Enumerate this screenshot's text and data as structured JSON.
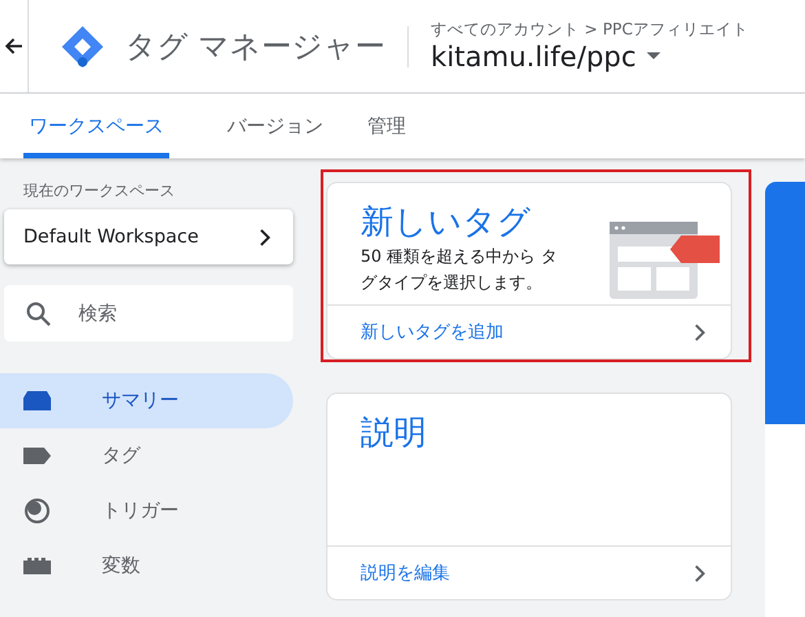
{
  "header": {
    "product": "タグ マネージャー",
    "breadcrumb": "すべてのアカウント > PPCアフィリエイト",
    "container": "kitamu.life/ppc"
  },
  "tabs": [
    {
      "label": "ワークスペース",
      "selected": true
    },
    {
      "label": "バージョン",
      "selected": false
    },
    {
      "label": "管理",
      "selected": false
    }
  ],
  "sidebar": {
    "workspace_label": "現在のワークスペース",
    "workspace": "Default Workspace",
    "search": {
      "placeholder": "検索"
    },
    "items": [
      {
        "label": "サマリー",
        "kind": "summary",
        "selected": true
      },
      {
        "label": "タグ",
        "kind": "tag",
        "selected": false
      },
      {
        "label": "トリガー",
        "kind": "trigger",
        "selected": false
      },
      {
        "label": "変数",
        "kind": "variable",
        "selected": false
      }
    ]
  },
  "cards": [
    {
      "title": "新しいタグ",
      "description": "50 種類を超える中から タグタイプを選択します。",
      "link": "新しいタグを追加",
      "highlighted": true
    },
    {
      "title": "説明",
      "link": "説明を編集",
      "highlighted": false
    }
  ]
}
